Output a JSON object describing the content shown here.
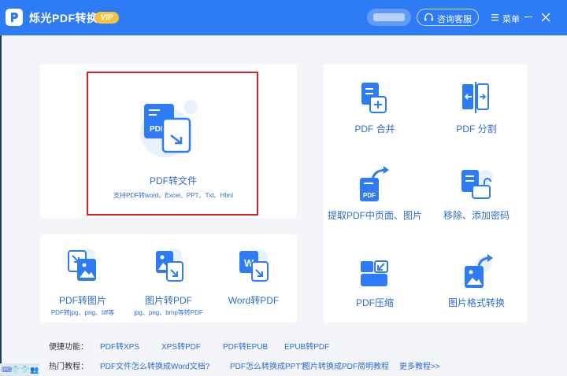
{
  "app": {
    "title": "烁光PDF转换器",
    "vip": "VIP"
  },
  "header": {
    "support": "咨询客服",
    "menu": "菜单"
  },
  "main": {
    "pdf_to_file": {
      "title": "PDF转文件",
      "subtitle": "支持PDF转word、Excel、PPT、Txt、Html"
    },
    "pdf_to_image": {
      "title": "PDF转图片",
      "subtitle": "PDF转jpg、png、tiff等"
    },
    "image_to_pdf": {
      "title": "图片转PDF",
      "subtitle": "jpg、png、bmp等转PDF"
    },
    "word_to_pdf": {
      "title": "Word转PDF"
    }
  },
  "right": {
    "merge": "PDF 合并",
    "split": "PDF 分割",
    "extract": "提取PDF中页面、图片",
    "password": "移除、添加密码",
    "compress": "PDF压缩",
    "image_format": "图片格式转换"
  },
  "shortcuts": {
    "label": "便捷功能：",
    "items": [
      "PDF转XPS",
      "XPS转PDF",
      "PDF转EPUB",
      "EPUB转PDF"
    ]
  },
  "tutorials": {
    "label": "热门教程：",
    "items": [
      "PDF文件怎么转换成Word文档?",
      "PDF怎么转换成PPT?",
      "图片转换成PDF简明教程",
      "更多教程>>"
    ]
  },
  "colors": {
    "brand": "#2d7cf6",
    "link": "#2d6bd6",
    "vip": "#f6c23d",
    "highlight": "#e02020"
  },
  "taskbar": {
    "icons": [
      "keyboard-icon",
      "shirt-icon",
      "shirt-icon",
      "people-icon"
    ]
  }
}
